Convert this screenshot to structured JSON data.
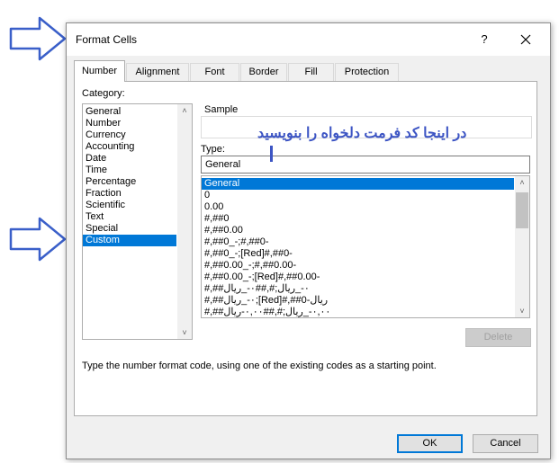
{
  "dialog": {
    "title": "Format Cells",
    "help_label": "?",
    "close_icon": "close-icon"
  },
  "tabs": [
    {
      "label": "Number",
      "active": true
    },
    {
      "label": "Alignment",
      "active": false
    },
    {
      "label": "Font",
      "active": false
    },
    {
      "label": "Border",
      "active": false
    },
    {
      "label": "Fill",
      "active": false
    },
    {
      "label": "Protection",
      "active": false
    }
  ],
  "category": {
    "label": "Category:",
    "items": [
      "General",
      "Number",
      "Currency",
      "Accounting",
      "Date",
      "Time",
      "Percentage",
      "Fraction",
      "Scientific",
      "Text",
      "Special",
      "Custom"
    ],
    "selected": "Custom"
  },
  "sample": {
    "label": "Sample"
  },
  "type": {
    "label": "Type:",
    "value": "General",
    "items": [
      "General",
      "0",
      "0.00",
      "#,##0",
      "#,##0.00",
      "#,##0_-;#,##0-",
      "#,##0_-;[Red]#,##0-",
      "#,##0.00_-;#,##0.00-",
      "#,##0.00_-;[Red]#,##0.00-",
      "#,##٠-_ريال;#,##٠-_ريال",
      "#,##٠-_ريال;[Red]#,##0-ريال",
      "#,##٠,٠٠-_ريال;#,##٠,٠٠-ريال"
    ],
    "selected": "General"
  },
  "annotation": "در اینجا کد فرمت دلخواه را بنویسید",
  "buttons": {
    "delete": "Delete",
    "ok": "OK",
    "cancel": "Cancel"
  },
  "hint": "Type the number format code, using one of the existing codes as a starting point.",
  "colors": {
    "accent": "#0078d7",
    "annotation": "#3d55c4",
    "pointer_arrow": "#3a5fc9"
  }
}
